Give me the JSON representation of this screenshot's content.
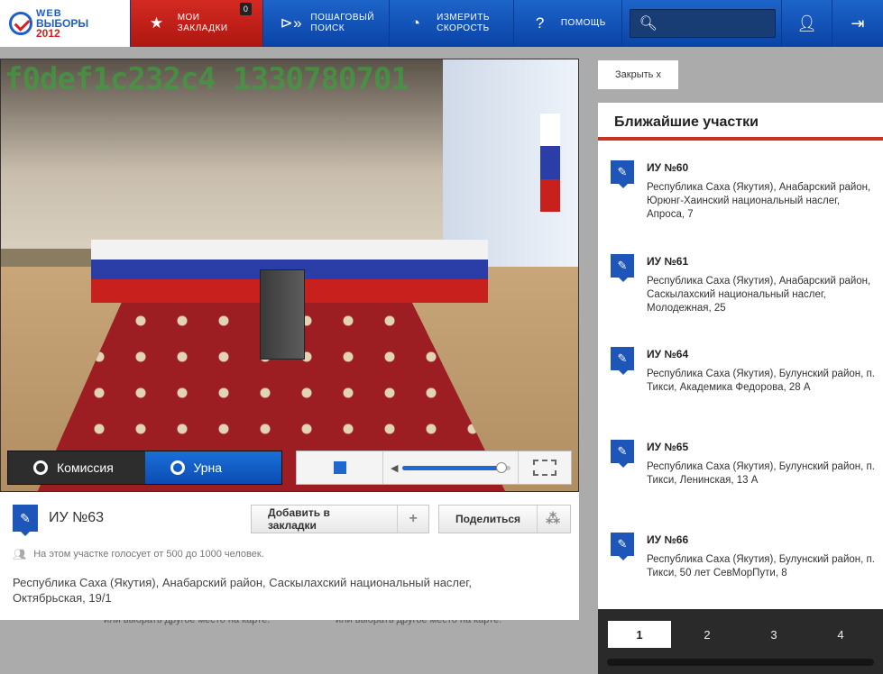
{
  "logo": {
    "line1": "WEB",
    "line2": "ВЫБОРЫ",
    "line3": "2012"
  },
  "nav": {
    "bookmarks": {
      "label1": "МОИ",
      "label2": "ЗАКЛАДКИ",
      "badge": "0"
    },
    "steps": {
      "label1": "ПОШАГОВЫЙ",
      "label2": "ПОИСК"
    },
    "speed": {
      "label1": "ИЗМЕРИТЬ",
      "label2": "СКОРОСТЬ"
    },
    "help": {
      "label": "ПОМОЩЬ"
    },
    "search": {
      "value": "",
      "placeholder": ""
    }
  },
  "video": {
    "watermark": "f0def1c232c4 1330780701",
    "tabs": [
      {
        "label": "Комиссия"
      },
      {
        "label": "Урна"
      }
    ],
    "volume_level": 0.92
  },
  "info": {
    "title": "ИУ №63",
    "add_bookmark": "Добавить в закладки",
    "share": "Поделиться",
    "voters": "На этом участке голосует от 500 до 1000 человек.",
    "address": "Республика Саха (Якутия), Анабарский район, Саскылахский национальный наслег, Октябрьская, 19/1"
  },
  "background": {
    "peek": "или выбрать другое место на карте."
  },
  "nearby": {
    "close": "Закрыть  x",
    "title": "Ближайшие участки",
    "sites": [
      {
        "name": "ИУ №60",
        "address": "Республика Саха (Якутия), Анабарский район, Юрюнг-Хаинский национальный наслег, Апроса, 7"
      },
      {
        "name": "ИУ №61",
        "address": "Республика Саха (Якутия), Анабарский район, Саскылахский национальный наслег, Молодежная, 25"
      },
      {
        "name": "ИУ №64",
        "address": "Республика Саха (Якутия), Булунский район, п. Тикси, Академика Федорова, 28 А"
      },
      {
        "name": "ИУ №65",
        "address": "Республика Саха (Якутия), Булунский район, п. Тикси, Ленинская, 13 А"
      },
      {
        "name": "ИУ №66",
        "address": "Республика Саха (Якутия), Булунский район, п. Тикси, 50 лет СевМорПути, 8"
      }
    ],
    "pages": [
      "1",
      "2",
      "3",
      "4"
    ]
  }
}
